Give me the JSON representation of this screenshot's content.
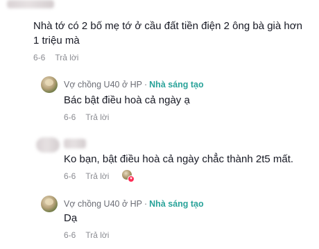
{
  "comments": [
    {
      "text_line1": "Nhà tớ có 2 bố mẹ tớ ở cầu đất tiền điện 2 ông bà già hơn",
      "text_line2": "1 triệu mà",
      "date": "6-6",
      "reply_label": "Trả lời"
    }
  ],
  "replies": [
    {
      "author": "Vợ chồng U40 ở HP",
      "separator": "·",
      "badge": "Nhà sáng tạo",
      "text": "Bác bật điều hoà cả ngày ạ",
      "date": "6-6",
      "reply_label": "Trả lời"
    },
    {
      "text": "Ko bạn, bật điều hoà cả ngày chẳc thành 2t5 mất.",
      "date": "6-6",
      "reply_label": "Trả lời",
      "liked_by_creator_icon": "creator-liked-icon"
    },
    {
      "author": "Vợ chồng U40 ở HP",
      "separator": "·",
      "badge": "Nhà sáng tạo",
      "text": "Dạ",
      "date": "6-6",
      "reply_label": "Trả lời"
    }
  ],
  "colors": {
    "text": "#161823",
    "meta": "#8a8b91",
    "badge": "#2aa39a",
    "heart": "#fe2c55"
  }
}
